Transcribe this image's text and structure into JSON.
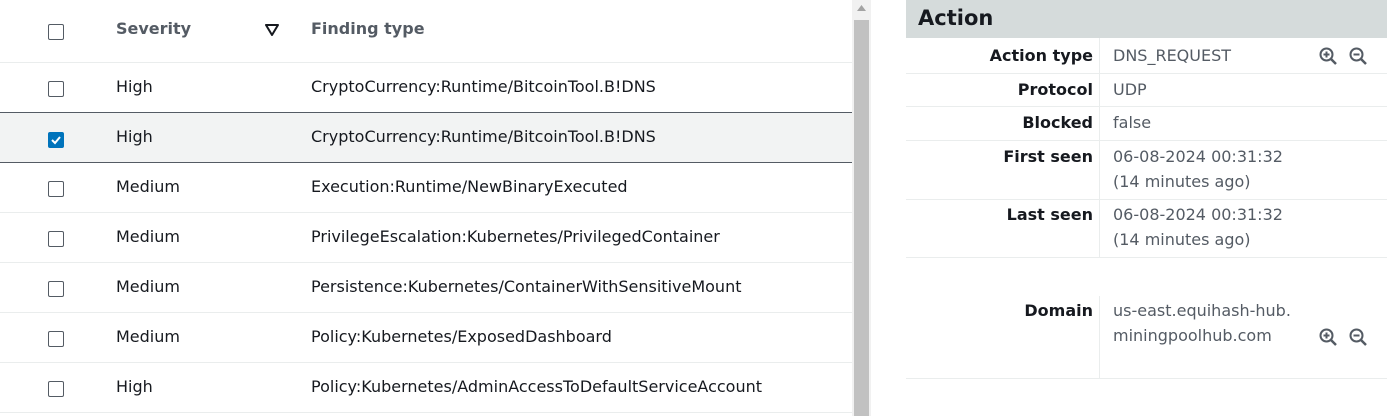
{
  "table": {
    "header": {
      "severity": "Severity",
      "finding_type": "Finding type"
    },
    "rows": [
      {
        "severity": "High",
        "finding_type": "CryptoCurrency:Runtime/BitcoinTool.B!DNS",
        "checked": false
      },
      {
        "severity": "High",
        "finding_type": "CryptoCurrency:Runtime/BitcoinTool.B!DNS",
        "checked": true
      },
      {
        "severity": "Medium",
        "finding_type": "Execution:Runtime/NewBinaryExecuted",
        "checked": false
      },
      {
        "severity": "Medium",
        "finding_type": "PrivilegeEscalation:Kubernetes/PrivilegedContainer",
        "checked": false
      },
      {
        "severity": "Medium",
        "finding_type": "Persistence:Kubernetes/ContainerWithSensitiveMount",
        "checked": false
      },
      {
        "severity": "Medium",
        "finding_type": "Policy:Kubernetes/ExposedDashboard",
        "checked": false
      },
      {
        "severity": "High",
        "finding_type": "Policy:Kubernetes/AdminAccessToDefaultServiceAccount",
        "checked": false
      }
    ]
  },
  "action": {
    "title": "Action",
    "fields": [
      {
        "label": "Action type",
        "value": "DNS_REQUEST"
      },
      {
        "label": "Protocol",
        "value": "UDP"
      },
      {
        "label": "Blocked",
        "value": "false"
      },
      {
        "label": "First seen",
        "value": "06-08-2024 00:31:32 (14 minutes ago)"
      },
      {
        "label": "Last seen",
        "value": "06-08-2024 00:31:32 (14 minutes ago)"
      },
      {
        "label": "Domain",
        "value": "us-east.equihash-hub.miningpoolhub.com"
      }
    ]
  },
  "colors": {
    "accent": "#0073bb",
    "header_bg": "#d5dbdb",
    "selected_row_bg": "#f2f3f3"
  },
  "icons": [
    "sort-down-icon",
    "checkbox-icon",
    "zoom-in-icon",
    "zoom-out-icon",
    "scroll-up-arrow-icon"
  ]
}
